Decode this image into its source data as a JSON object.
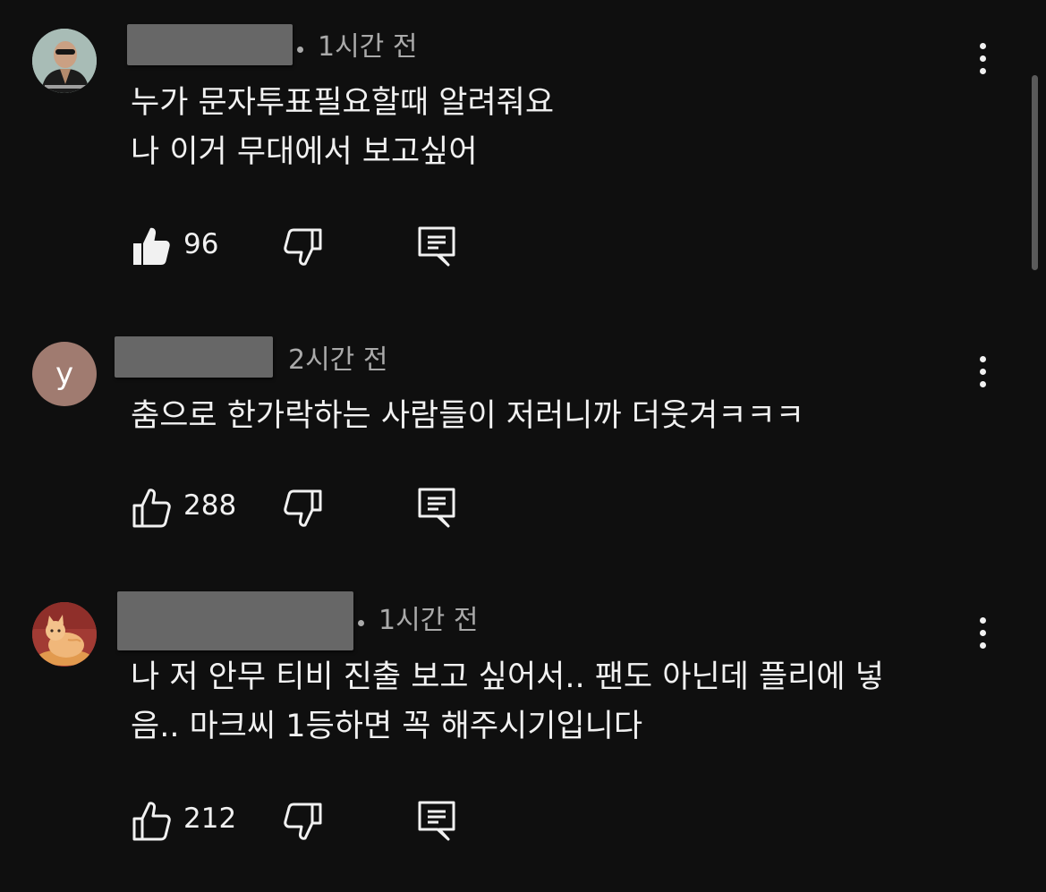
{
  "comments": [
    {
      "timestamp": "1시간 전",
      "lines": [
        "누가 문자투표필요할때 알려줘요",
        "나 이거 무대에서 보고싶어"
      ],
      "likes": "96",
      "liked": true,
      "avatar": "photo-person"
    },
    {
      "timestamp": "2시간 전",
      "lines": [
        "춤으로 한가락하는 사람들이 저러니까 더웃겨ㅋㅋㅋ"
      ],
      "likes": "288",
      "liked": false,
      "avatar_letter": "y",
      "avatar_color": "#a07b70"
    },
    {
      "timestamp": "1시간 전",
      "lines": [
        "나 저 안무 티비 진출 보고 싶어서.. 팬도 아닌데 플리에 넣",
        "음.. 마크씨 1등하면 꼭 해주시기입니다"
      ],
      "likes": "212",
      "liked": false,
      "avatar": "illustration-cat"
    }
  ],
  "icons": {
    "like": "thumbs-up-icon",
    "dislike": "thumbs-down-icon",
    "reply": "comment-reply-icon",
    "menu": "more-vertical-icon"
  },
  "colors": {
    "background": "#0f0f0f",
    "text": "#f1f1f1",
    "secondary_text": "#aaaaaa",
    "redaction": "#676767"
  }
}
